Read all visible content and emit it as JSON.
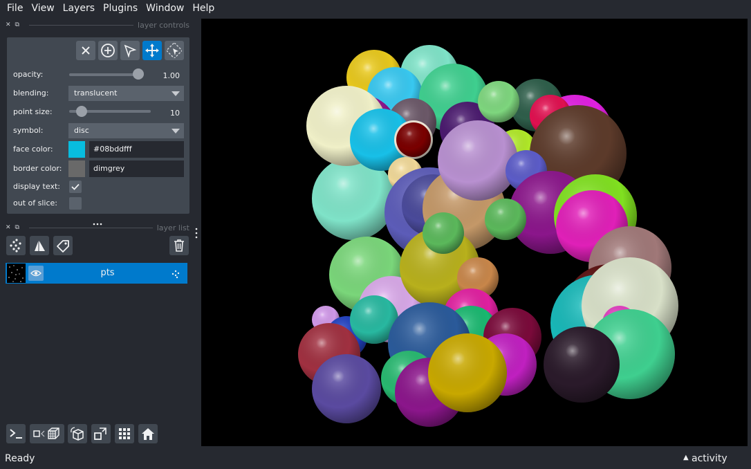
{
  "menu": {
    "file": "File",
    "view": "View",
    "layers": "Layers",
    "plugins": "Plugins",
    "window": "Window",
    "help": "Help"
  },
  "layer_controls": {
    "title": "layer controls",
    "tools": [
      "delete-icon",
      "add-point-icon",
      "select-arrow-icon",
      "pan-zoom-icon",
      "lasso-select-icon"
    ],
    "active_tool": "pan-zoom-icon",
    "opacity_label": "opacity:",
    "opacity_value": "1.00",
    "opacity_fraction": 1.0,
    "blending_label": "blending:",
    "blending_value": "translucent",
    "point_size_label": "point size:",
    "point_size_value": "10",
    "point_size_fraction": 0.1,
    "symbol_label": "symbol:",
    "symbol_value": "disc",
    "face_color_label": "face color:",
    "face_color_value": "#08bddfff",
    "face_color_swatch": "#08bddf",
    "border_color_label": "border color:",
    "border_color_value": "dimgrey",
    "border_color_swatch": "#696969",
    "display_text_label": "display text:",
    "display_text_checked": true,
    "out_of_slice_label": "out of slice:",
    "out_of_slice_checked": false
  },
  "layer_list": {
    "title": "layer list",
    "tools": [
      "new-points-icon",
      "new-shapes-icon",
      "new-labels-icon",
      "delete-layer-icon"
    ],
    "layers": [
      {
        "name": "pts",
        "visible": true,
        "type_icon": "points-type-icon"
      }
    ]
  },
  "bottom_toolbar": [
    "console-icon",
    "toggle-ndisplay-icon",
    "roll-dims-icon",
    "transpose-icon",
    "grid-icon",
    "home-icon"
  ],
  "status": {
    "text": "Ready",
    "activity": "activity"
  },
  "colors": {
    "accent": "#007acc",
    "background": "#262930",
    "panel": "#414851"
  }
}
